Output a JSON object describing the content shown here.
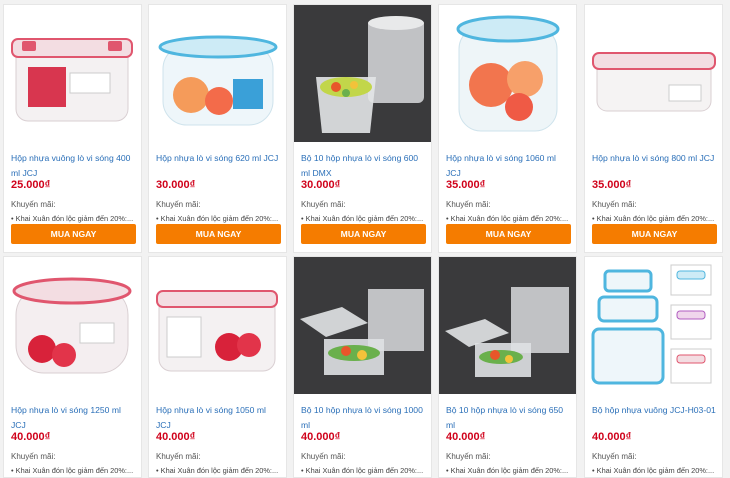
{
  "buy_label": "MUA NGAY",
  "promo_label": "Khuyến mãi:",
  "promo_text": "• Khai Xuân đón lộc giảm đến 20%:...",
  "products": [
    {
      "title": "Hộp nhựa vuông lò vi sóng 400 ml JCJ",
      "price": "25.000₫"
    },
    {
      "title": "Hộp nhựa lò vi sóng 620 ml JCJ",
      "price": "30.000₫"
    },
    {
      "title": "Bộ 10 hộp nhựa lò vi sóng 600 ml DMX",
      "price": "30.000₫"
    },
    {
      "title": "Hộp nhựa lò vi sóng 1060 ml JCJ",
      "price": "35.000₫"
    },
    {
      "title": "Hộp nhựa lò vi sóng 800 ml JCJ",
      "price": "35.000₫"
    },
    {
      "title": "Hộp nhựa lò vi sóng 1250 ml JCJ",
      "price": "40.000₫"
    },
    {
      "title": "Hộp nhựa lò vi sóng 1050 ml JCJ",
      "price": "40.000₫"
    },
    {
      "title": "Bộ 10 hộp nhựa lò vi sóng 1000 ml",
      "price": "40.000₫"
    },
    {
      "title": "Bộ 10 hộp nhựa lò vi sóng 650 ml",
      "price": "40.000₫"
    },
    {
      "title": "Bộ hộp nhựa vuông JCJ-H03-01",
      "price": "40.000₫"
    }
  ],
  "colors": {
    "accent_orange": "#f57c00",
    "price_red": "#d0021b",
    "link_blue": "#2a6fb8",
    "lid_pink": "#e0566e",
    "lid_blue": "#4fb6df"
  }
}
